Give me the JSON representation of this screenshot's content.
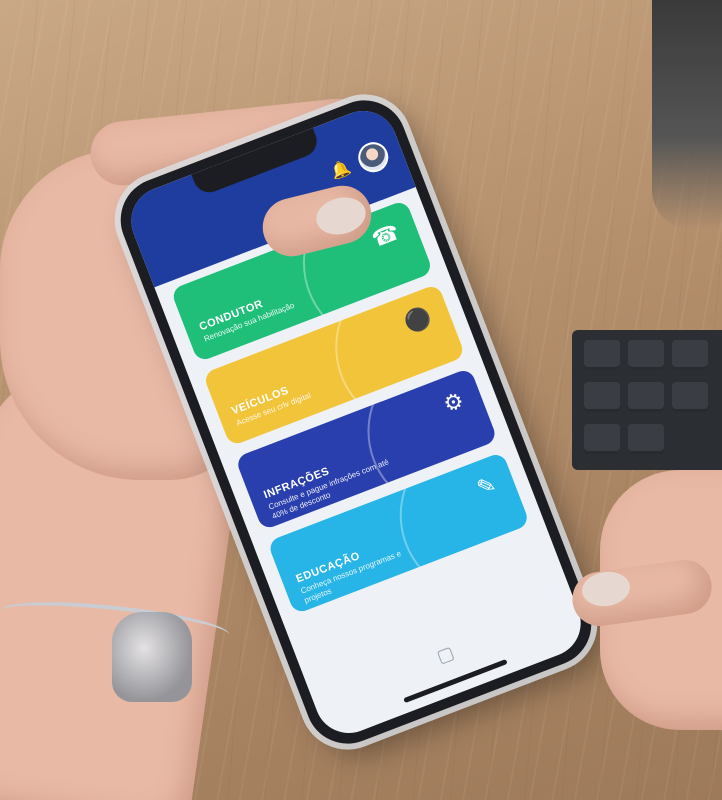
{
  "app": {
    "header_icons": {
      "notification": "bell-icon",
      "profile": "avatar"
    },
    "cards": [
      {
        "title": "CONDUTOR",
        "subtitle": "Renovação sua habilitação",
        "color": "#1fbf7a",
        "icon": "driver-icon"
      },
      {
        "title": "VEÍCULOS",
        "subtitle": "Acesse seu crlv digital",
        "color": "#f2c43a",
        "icon": "car-icon"
      },
      {
        "title": "INFRAÇÕES",
        "subtitle": "Consulte e pague infrações com até 40% de desconto",
        "color": "#2a3fae",
        "icon": "ticket-icon"
      },
      {
        "title": "EDUCAÇÃO",
        "subtitle": "Conheça nossos programas e projetos",
        "color": "#27b4e6",
        "icon": "education-icon"
      }
    ]
  }
}
